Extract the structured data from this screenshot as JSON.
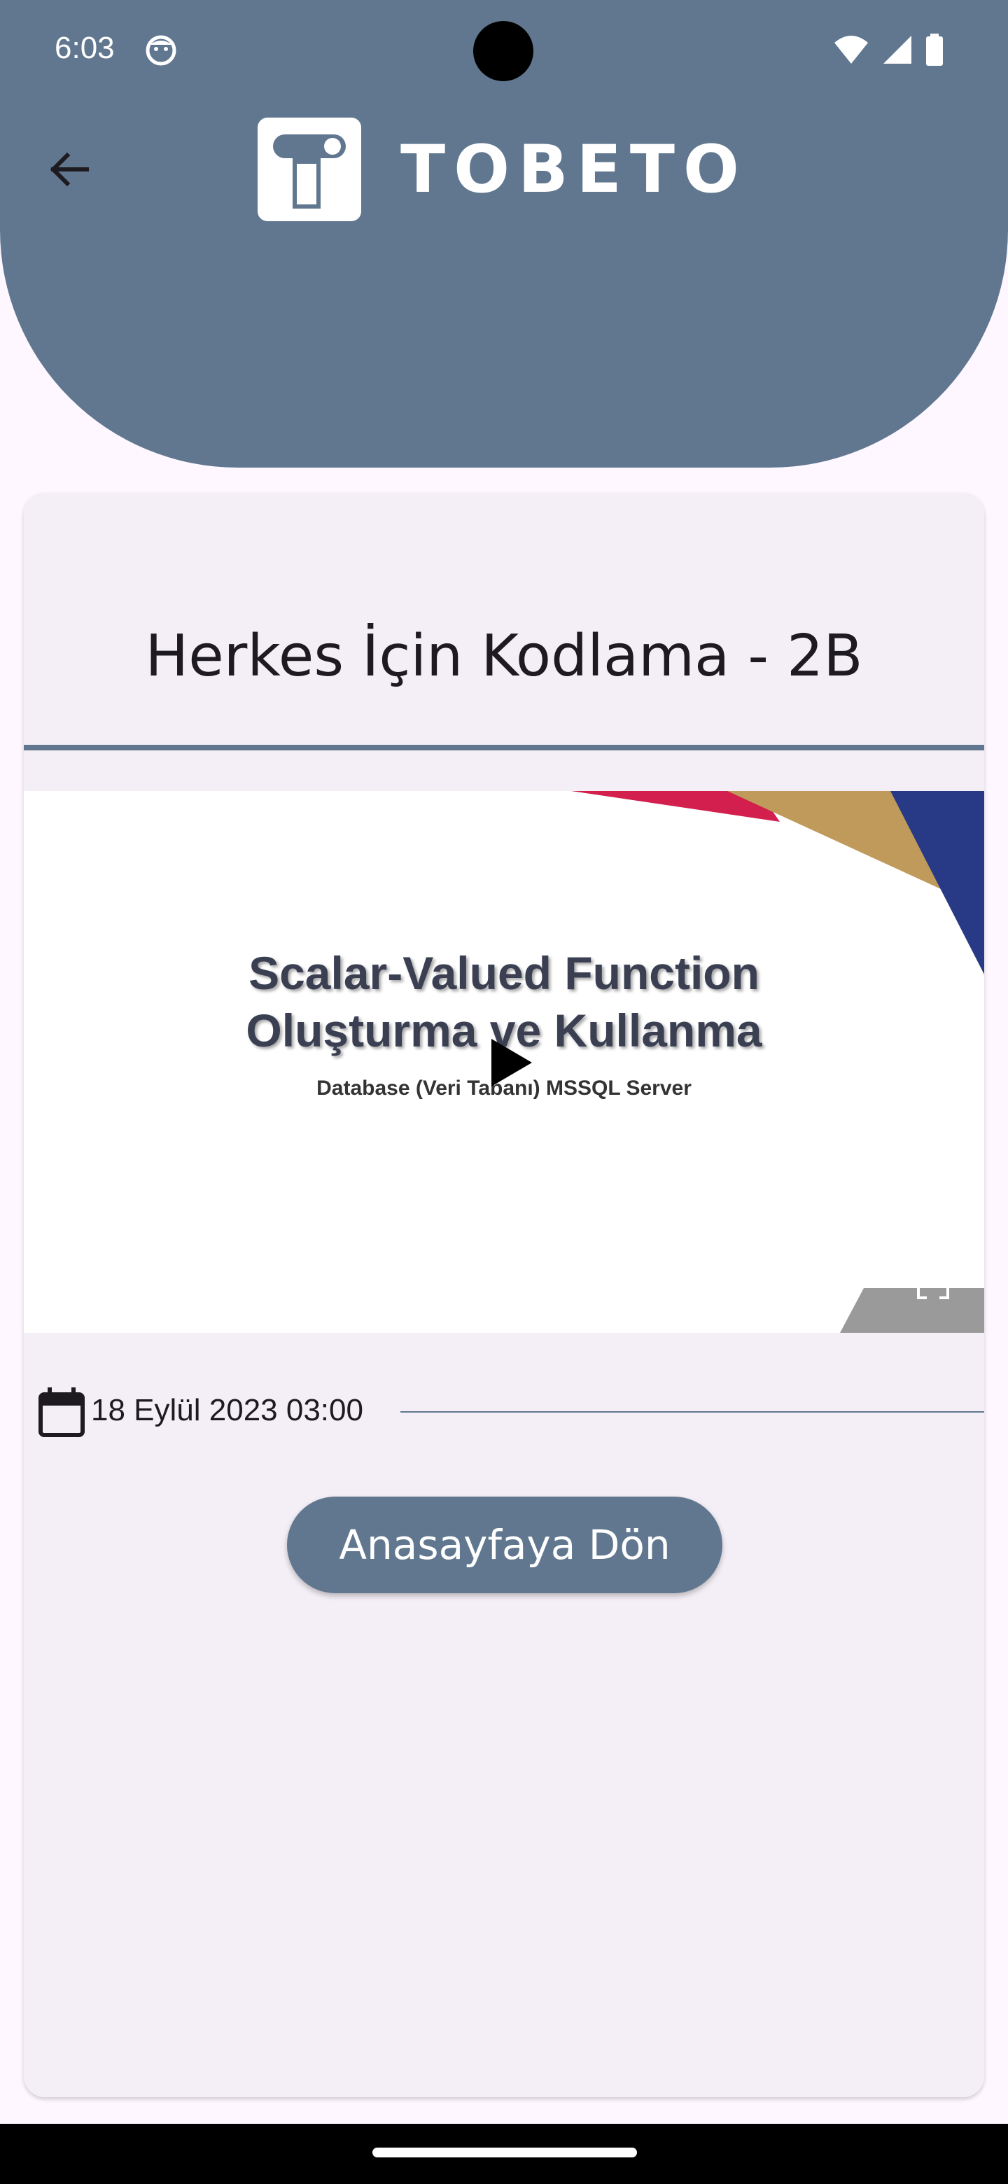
{
  "status_bar": {
    "time": "6:03"
  },
  "header": {
    "logo_text": "TOBETO",
    "background_color": "#60778F"
  },
  "card": {
    "title": "Herkes İçin Kodlama - 2B"
  },
  "video": {
    "slide_title_line1": "Scalar-Valued Function",
    "slide_title_line2": "Oluşturma ve Kullanma",
    "slide_subtitle": "Database (Veri Tabanı) MSSQL Server"
  },
  "date": {
    "text": "18 Eylül 2023 03:00"
  },
  "actions": {
    "home_button_label": "Anasayfaya Dön"
  },
  "icons": {
    "back": "arrow-back-icon",
    "calendar": "calendar-icon",
    "play": "play-icon",
    "fullscreen": "fullscreen-icon"
  }
}
